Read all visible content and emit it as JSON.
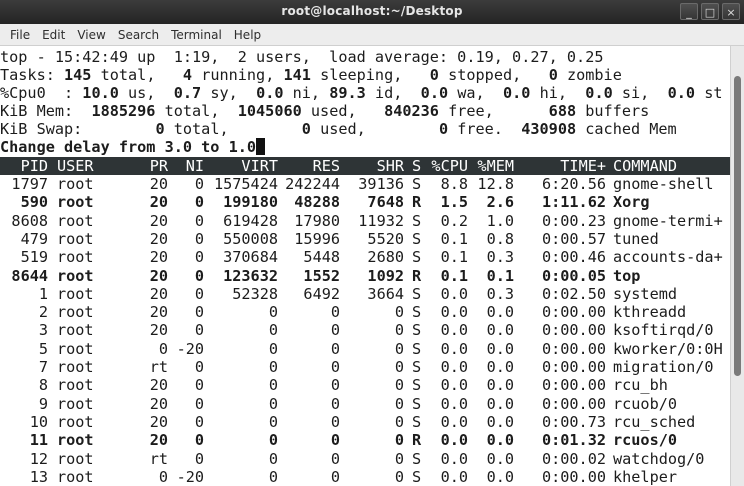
{
  "window": {
    "title": "root@localhost:~/Desktop",
    "min_label": "_",
    "max_label": "□",
    "close_label": "×"
  },
  "menu": [
    "File",
    "Edit",
    "View",
    "Search",
    "Terminal",
    "Help"
  ],
  "summary": {
    "line1": "top - 15:42:49 up  1:19,  2 users,  load average: 0.19, 0.27, 0.25",
    "tasks": [
      "Tasks: ",
      "145",
      " total,   ",
      "4",
      " running, ",
      "141",
      " sleeping,   ",
      "0",
      " stopped,   ",
      "0",
      " zombie"
    ],
    "cpu": [
      "%Cpu0  : ",
      "10.0",
      " us,  ",
      "0.7",
      " sy,  ",
      "0.0",
      " ni, ",
      "89.3",
      " id,  ",
      "0.0",
      " wa,  ",
      "0.0",
      " hi,  ",
      "0.0",
      " si,  ",
      "0.0",
      " st"
    ],
    "mem": [
      "KiB Mem:  ",
      "1885296",
      " total,  ",
      "1045060",
      " used,   ",
      "840236",
      " free,      ",
      "688",
      " buffers"
    ],
    "swap": [
      "KiB Swap:        ",
      "0",
      " total,        ",
      "0",
      " used,        ",
      "0",
      " free.  ",
      "430908",
      " cached Mem"
    ],
    "prompt": "Change delay from 3.0 to 1.0"
  },
  "columns": [
    "PID",
    "USER",
    "PR",
    "NI",
    "VIRT",
    "RES",
    "SHR",
    "S",
    "%CPU",
    "%MEM",
    "TIME+",
    "COMMAND"
  ],
  "processes": [
    {
      "pid": "1797",
      "user": "root",
      "pr": "20",
      "ni": "0",
      "virt": "1575424",
      "res": "242244",
      "shr": "39136",
      "s": "S",
      "cpu": "8.8",
      "mem": "12.8",
      "time": "6:20.56",
      "cmd": "gnome-shell",
      "bold": false
    },
    {
      "pid": "590",
      "user": "root",
      "pr": "20",
      "ni": "0",
      "virt": "199180",
      "res": "48288",
      "shr": "7648",
      "s": "R",
      "cpu": "1.5",
      "mem": "2.6",
      "time": "1:11.62",
      "cmd": "Xorg",
      "bold": true
    },
    {
      "pid": "8608",
      "user": "root",
      "pr": "20",
      "ni": "0",
      "virt": "619428",
      "res": "17980",
      "shr": "11932",
      "s": "S",
      "cpu": "0.2",
      "mem": "1.0",
      "time": "0:00.23",
      "cmd": "gnome-termi+",
      "bold": false
    },
    {
      "pid": "479",
      "user": "root",
      "pr": "20",
      "ni": "0",
      "virt": "550008",
      "res": "15996",
      "shr": "5520",
      "s": "S",
      "cpu": "0.1",
      "mem": "0.8",
      "time": "0:00.57",
      "cmd": "tuned",
      "bold": false
    },
    {
      "pid": "519",
      "user": "root",
      "pr": "20",
      "ni": "0",
      "virt": "370684",
      "res": "5448",
      "shr": "2680",
      "s": "S",
      "cpu": "0.1",
      "mem": "0.3",
      "time": "0:00.46",
      "cmd": "accounts-da+",
      "bold": false
    },
    {
      "pid": "8644",
      "user": "root",
      "pr": "20",
      "ni": "0",
      "virt": "123632",
      "res": "1552",
      "shr": "1092",
      "s": "R",
      "cpu": "0.1",
      "mem": "0.1",
      "time": "0:00.05",
      "cmd": "top",
      "bold": true
    },
    {
      "pid": "1",
      "user": "root",
      "pr": "20",
      "ni": "0",
      "virt": "52328",
      "res": "6492",
      "shr": "3664",
      "s": "S",
      "cpu": "0.0",
      "mem": "0.3",
      "time": "0:02.50",
      "cmd": "systemd",
      "bold": false
    },
    {
      "pid": "2",
      "user": "root",
      "pr": "20",
      "ni": "0",
      "virt": "0",
      "res": "0",
      "shr": "0",
      "s": "S",
      "cpu": "0.0",
      "mem": "0.0",
      "time": "0:00.00",
      "cmd": "kthreadd",
      "bold": false
    },
    {
      "pid": "3",
      "user": "root",
      "pr": "20",
      "ni": "0",
      "virt": "0",
      "res": "0",
      "shr": "0",
      "s": "S",
      "cpu": "0.0",
      "mem": "0.0",
      "time": "0:00.00",
      "cmd": "ksoftirqd/0",
      "bold": false
    },
    {
      "pid": "5",
      "user": "root",
      "pr": "0",
      "ni": "-20",
      "virt": "0",
      "res": "0",
      "shr": "0",
      "s": "S",
      "cpu": "0.0",
      "mem": "0.0",
      "time": "0:00.00",
      "cmd": "kworker/0:0H",
      "bold": false
    },
    {
      "pid": "7",
      "user": "root",
      "pr": "rt",
      "ni": "0",
      "virt": "0",
      "res": "0",
      "shr": "0",
      "s": "S",
      "cpu": "0.0",
      "mem": "0.0",
      "time": "0:00.00",
      "cmd": "migration/0",
      "bold": false
    },
    {
      "pid": "8",
      "user": "root",
      "pr": "20",
      "ni": "0",
      "virt": "0",
      "res": "0",
      "shr": "0",
      "s": "S",
      "cpu": "0.0",
      "mem": "0.0",
      "time": "0:00.00",
      "cmd": "rcu_bh",
      "bold": false
    },
    {
      "pid": "9",
      "user": "root",
      "pr": "20",
      "ni": "0",
      "virt": "0",
      "res": "0",
      "shr": "0",
      "s": "S",
      "cpu": "0.0",
      "mem": "0.0",
      "time": "0:00.00",
      "cmd": "rcuob/0",
      "bold": false
    },
    {
      "pid": "10",
      "user": "root",
      "pr": "20",
      "ni": "0",
      "virt": "0",
      "res": "0",
      "shr": "0",
      "s": "S",
      "cpu": "0.0",
      "mem": "0.0",
      "time": "0:00.73",
      "cmd": "rcu_sched",
      "bold": false
    },
    {
      "pid": "11",
      "user": "root",
      "pr": "20",
      "ni": "0",
      "virt": "0",
      "res": "0",
      "shr": "0",
      "s": "R",
      "cpu": "0.0",
      "mem": "0.0",
      "time": "0:01.32",
      "cmd": "rcuos/0",
      "bold": true
    },
    {
      "pid": "12",
      "user": "root",
      "pr": "rt",
      "ni": "0",
      "virt": "0",
      "res": "0",
      "shr": "0",
      "s": "S",
      "cpu": "0.0",
      "mem": "0.0",
      "time": "0:00.02",
      "cmd": "watchdog/0",
      "bold": false
    },
    {
      "pid": "13",
      "user": "root",
      "pr": "0",
      "ni": "-20",
      "virt": "0",
      "res": "0",
      "shr": "0",
      "s": "S",
      "cpu": "0.0",
      "mem": "0.0",
      "time": "0:00.00",
      "cmd": "khelper",
      "bold": false
    }
  ]
}
